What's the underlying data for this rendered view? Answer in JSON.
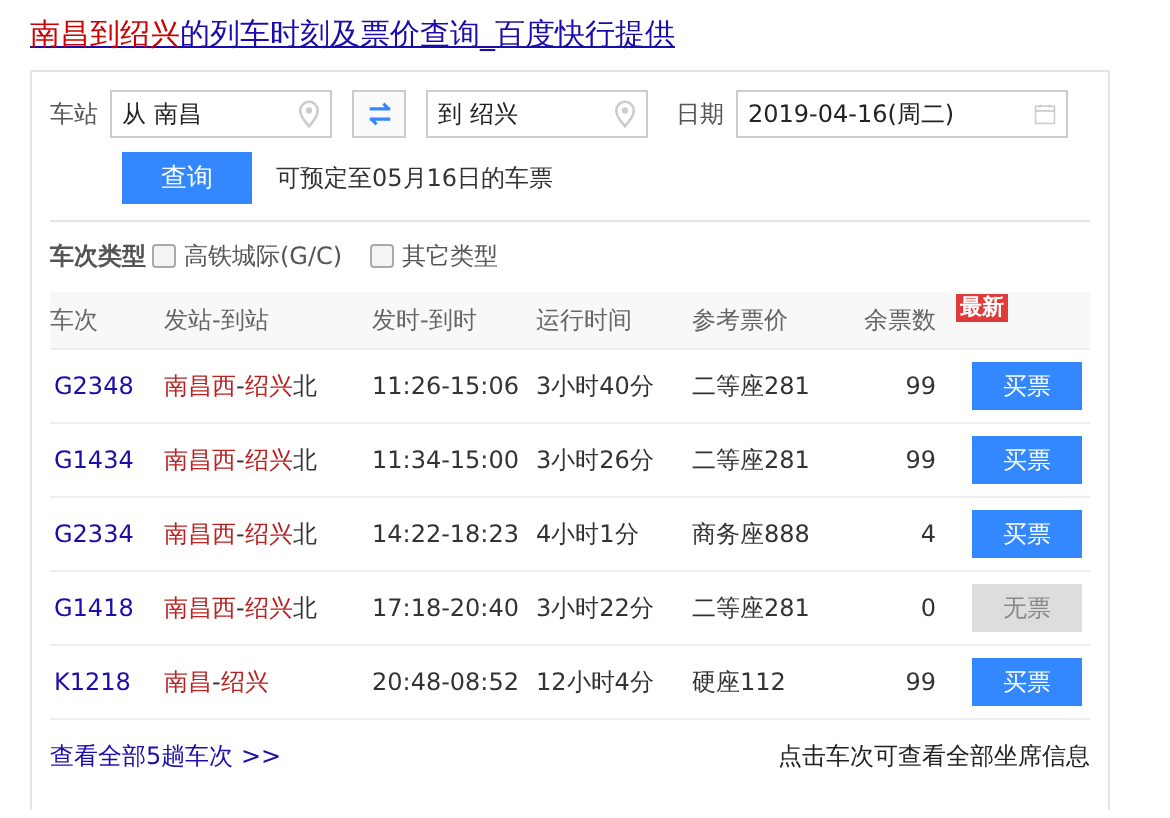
{
  "title": [
    {
      "text": "南昌到绍兴",
      "highlight": true
    },
    {
      "text": "的列车时刻及票价查询_百度快行提供",
      "highlight": false
    }
  ],
  "search": {
    "station_label": "车站",
    "from": "从 南昌",
    "to": "到 绍兴",
    "date_label": "日期",
    "date": "2019-04-16(周二)",
    "submit": "查询",
    "note": "可预定至05月16日的车票"
  },
  "filter": {
    "label": "车次类型",
    "options": [
      {
        "label": "高铁城际(G/C)",
        "checked": false
      },
      {
        "label": "其它类型",
        "checked": false
      }
    ]
  },
  "table": {
    "columns": [
      "车次",
      "发站-到站",
      "发时-到时",
      "运行时间",
      "参考票价",
      "余票数"
    ],
    "badge": "最新",
    "rows": [
      {
        "train": "G2348",
        "route": [
          {
            "text": "南昌西",
            "highlight": true
          },
          {
            "text": "-",
            "highlight": false
          },
          {
            "text": "绍兴",
            "highlight": true
          },
          {
            "text": "北",
            "highlight": false
          }
        ],
        "times": "11:26-15:06",
        "duration": "3小时40分",
        "price": "二等座281",
        "remaining": "99",
        "button": "买票",
        "available": true
      },
      {
        "train": "G1434",
        "route": [
          {
            "text": "南昌西",
            "highlight": true
          },
          {
            "text": "-",
            "highlight": false
          },
          {
            "text": "绍兴",
            "highlight": true
          },
          {
            "text": "北",
            "highlight": false
          }
        ],
        "times": "11:34-15:00",
        "duration": "3小时26分",
        "price": "二等座281",
        "remaining": "99",
        "button": "买票",
        "available": true
      },
      {
        "train": "G2334",
        "route": [
          {
            "text": "南昌西",
            "highlight": true
          },
          {
            "text": "-",
            "highlight": false
          },
          {
            "text": "绍兴",
            "highlight": true
          },
          {
            "text": "北",
            "highlight": false
          }
        ],
        "times": "14:22-18:23",
        "duration": "4小时1分",
        "price": "商务座888",
        "remaining": "4",
        "button": "买票",
        "available": true
      },
      {
        "train": "G1418",
        "route": [
          {
            "text": "南昌西",
            "highlight": true
          },
          {
            "text": "-",
            "highlight": false
          },
          {
            "text": "绍兴",
            "highlight": true
          },
          {
            "text": "北",
            "highlight": false
          }
        ],
        "times": "17:18-20:40",
        "duration": "3小时22分",
        "price": "二等座281",
        "remaining": "0",
        "button": "无票",
        "available": false
      },
      {
        "train": "K1218",
        "route": [
          {
            "text": "南昌",
            "highlight": true
          },
          {
            "text": "-",
            "highlight": false
          },
          {
            "text": "绍兴",
            "highlight": true
          }
        ],
        "times": "20:48-08:52",
        "duration": "12小时4分",
        "price": "硬座112",
        "remaining": "99",
        "button": "买票",
        "available": true
      }
    ]
  },
  "footer": {
    "link": "查看全部5趟车次 >>",
    "hint": "点击车次可查看全部坐席信息"
  }
}
